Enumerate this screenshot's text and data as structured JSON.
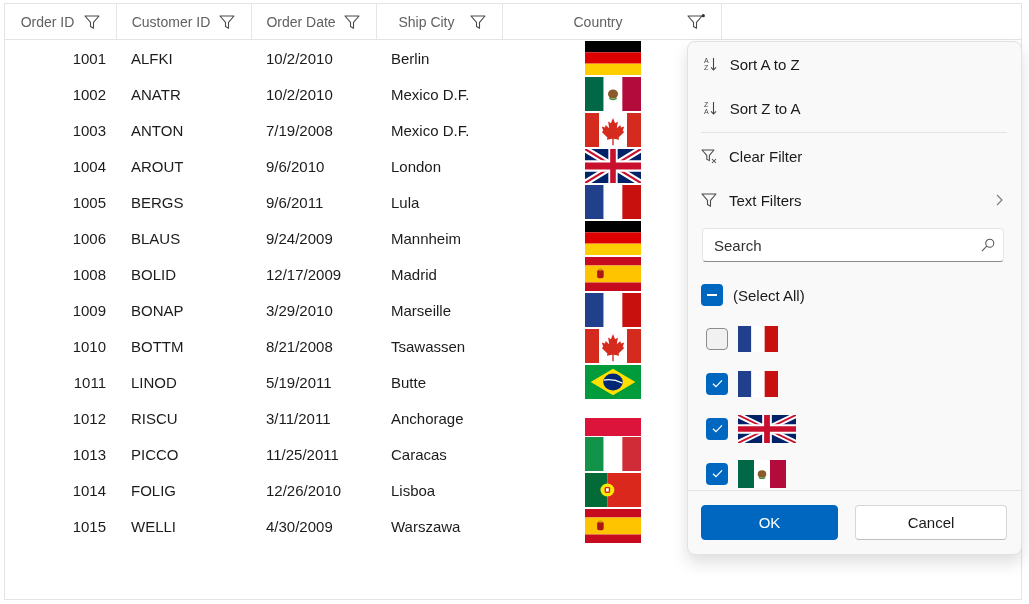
{
  "columns": [
    {
      "label": "Order ID",
      "filtered": false
    },
    {
      "label": "Customer ID",
      "filtered": false
    },
    {
      "label": "Order Date",
      "filtered": false
    },
    {
      "label": "Ship City",
      "filtered": false
    },
    {
      "label": "Country",
      "filtered": true
    }
  ],
  "rows": [
    {
      "order_id": "1001",
      "customer_id": "ALFKI",
      "order_date": "10/2/2010",
      "ship_city": "Berlin",
      "country": {
        "kind": "germany"
      }
    },
    {
      "order_id": "1002",
      "customer_id": "ANATR",
      "order_date": "10/2/2010",
      "ship_city": "Mexico D.F.",
      "country": {
        "kind": "mexico"
      }
    },
    {
      "order_id": "1003",
      "customer_id": "ANTON",
      "order_date": "7/19/2008",
      "ship_city": "Mexico D.F.",
      "country": {
        "kind": "canada"
      }
    },
    {
      "order_id": "1004",
      "customer_id": "AROUT",
      "order_date": "9/6/2010",
      "ship_city": "London",
      "country": {
        "kind": "uk"
      }
    },
    {
      "order_id": "1005",
      "customer_id": "BERGS",
      "order_date": "9/6/2011",
      "ship_city": "Lula",
      "country": {
        "kind": "france"
      }
    },
    {
      "order_id": "1006",
      "customer_id": "BLAUS",
      "order_date": "9/24/2009",
      "ship_city": "Mannheim",
      "country": {
        "kind": "germany"
      }
    },
    {
      "order_id": "1008",
      "customer_id": "BOLID",
      "order_date": "12/17/2009",
      "ship_city": "Madrid",
      "country": {
        "kind": "spain"
      }
    },
    {
      "order_id": "1009",
      "customer_id": "BONAP",
      "order_date": "3/29/2010",
      "ship_city": "Marseille",
      "country": {
        "kind": "france"
      }
    },
    {
      "order_id": "1010",
      "customer_id": "BOTTM",
      "order_date": "8/21/2008",
      "ship_city": "Tsawassen",
      "country": {
        "kind": "canada"
      }
    },
    {
      "order_id": "1011",
      "customer_id": "LINOD",
      "order_date": "5/19/2011",
      "ship_city": "Butte",
      "country": {
        "kind": "brazil"
      }
    },
    {
      "order_id": "1012",
      "customer_id": "RISCU",
      "order_date": "3/11/2011",
      "ship_city": "Anchorage",
      "country": {
        "kind": "band"
      }
    },
    {
      "order_id": "1013",
      "customer_id": "PICCO",
      "order_date": "11/25/2011",
      "ship_city": "Caracas",
      "country": {
        "kind": "italy"
      }
    },
    {
      "order_id": "1014",
      "customer_id": "FOLIG",
      "order_date": "12/26/2010",
      "ship_city": "Lisboa",
      "country": {
        "kind": "portugal"
      }
    },
    {
      "order_id": "1015",
      "customer_id": "WELLI",
      "order_date": "4/30/2009",
      "ship_city": "Warszawa",
      "country": {
        "kind": "spain"
      }
    }
  ],
  "filter_popup": {
    "menu_groups": [
      {
        "items": [
          {
            "kind": "ascending",
            "label": "Sort A to Z",
            "icon_letters": [
              "A",
              "Z"
            ],
            "submenu": false
          },
          {
            "kind": "descending",
            "label": "Sort Z to A",
            "icon_letters": [
              "Z",
              "A"
            ],
            "submenu": false
          }
        ]
      },
      {
        "items": [
          {
            "kind": "clear",
            "label": "Clear Filter",
            "submenu": false
          },
          {
            "kind": "filters",
            "label": "Text Filters",
            "submenu": true
          }
        ]
      }
    ],
    "search": {
      "placeholder": "Search"
    },
    "select_all": {
      "label": "(Select All)",
      "indeterminate": true
    },
    "items": [
      {
        "checked": false,
        "kind": "france"
      },
      {
        "checked": true,
        "kind": "france"
      },
      {
        "checked": true,
        "kind": "uk"
      },
      {
        "checked": true,
        "kind": "mexico"
      }
    ],
    "buttons": [
      {
        "kind": "primary",
        "label": "OK"
      },
      {
        "kind": "secondary",
        "label": "Cancel"
      }
    ]
  }
}
